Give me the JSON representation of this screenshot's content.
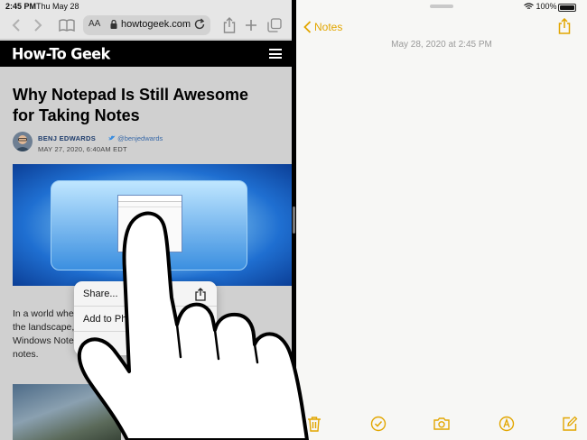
{
  "status_bar": {
    "time": "2:45 PM",
    "date": "Thu May 28",
    "battery": "100%"
  },
  "safari": {
    "address_bar": {
      "text_size_label": "AA",
      "url": "howtogeek.com"
    },
    "site_logo": "How-To Geek",
    "article": {
      "headline_line1": "Why Notepad Is Still Awesome",
      "headline_line2": "for Taking Notes",
      "author": "BENJ EDWARDS",
      "twitter_handle": "@benjedwards",
      "published": "MAY 27, 2020, 6:40AM EDT",
      "body_lines": [
        "In a world wher                                        king apps litter",
        "the landscape,                                         licity:",
        "Windows Notep",
        "notes."
      ]
    },
    "context_menu": {
      "items": [
        {
          "label": "Share...",
          "icon": "share-icon"
        },
        {
          "label": "Add to Pho",
          "icon": ""
        }
      ]
    }
  },
  "notes": {
    "back_label": "Notes",
    "note_date": "May 28, 2020 at 2:45 PM",
    "toolbar_icons": [
      "trash-icon",
      "checklist-icon",
      "camera-icon",
      "markup-icon",
      "compose-icon"
    ],
    "accent_color": "#E2A600"
  }
}
